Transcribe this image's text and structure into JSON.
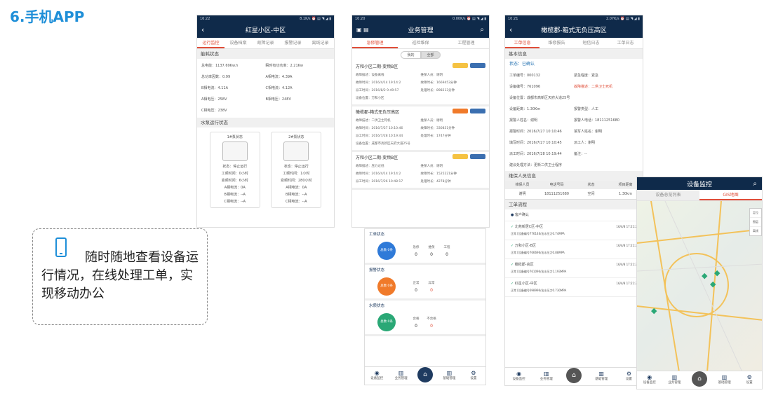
{
  "slide_title": "6.手机APP",
  "callout": "随时随地查看设备运行情况，在线处理工单，实现移动办公",
  "p1": {
    "status_time": "16:22",
    "status_right": "8.1K/s ⏰ ▤ ◥ ◢ ▮",
    "title": "红星小区-中区",
    "tabs": [
      "运行监控",
      "设备档案",
      "故障记录",
      "报警记录",
      "离线记录"
    ],
    "sec1": "能耗状态",
    "rows": [
      [
        "总电能：1137.69Kw.h",
        "瞬时有功功率：2.21Kw"
      ],
      [
        "总功率因数：0.99",
        "A相电流：4.39A"
      ],
      [
        "B相电流：4.11A",
        "C相电流：4.12A"
      ],
      [
        "A相电压：258V",
        "B相电压：248V"
      ],
      [
        "C相电压：238V",
        ""
      ]
    ],
    "sec2": "水泵运行状态",
    "pumps": [
      {
        "name": "1#泵状态",
        "lines": [
          "状态：停止运行",
          "工频时间：0小时",
          "变频时间：6小时",
          "A相电流：0A",
          "B相电流：--A",
          "C相电流：--A"
        ]
      },
      {
        "name": "2#泵状态",
        "lines": [
          "状态：停止运行",
          "工频时间：1小时",
          "变频时间：280小时",
          "A相电流：0A",
          "B相电流：--A",
          "C相电流：--A"
        ]
      }
    ]
  },
  "p2": {
    "status_time": "10:20",
    "status_right": "0.00K/s ⏰ ▤ ◥ ◢ ▮",
    "title": "业务管理",
    "tabs": [
      "急修管理",
      "巡检维保",
      "工程管理"
    ],
    "toggle": [
      "我的",
      "全部"
    ],
    "cards": [
      {
        "title": "万和小区二期-变频B区",
        "b1": "#f5c242",
        "b2": "#3b6fb0",
        "kv": [
          [
            "故障描述：设备离线",
            "维保人员：谢明"
          ],
          [
            "故障时间：2016/4/14 19:14:2",
            "故障时长：1669453分钟"
          ],
          [
            "派工时间：2016/8/2 9:49:57",
            "处理时长：898213分钟"
          ],
          [
            "设备位置：万和小区",
            ""
          ]
        ]
      },
      {
        "title": "橄榄郡-箱式无负压高区",
        "b1": "#f07a2a",
        "b2": "#3b6fb0",
        "kv": [
          [
            "故障描述：二供卫士死机",
            "维保人员：谢明"
          ],
          [
            "故障时间：2016/7/27 10:10:46",
            "故障时长：330831分钟"
          ],
          [
            "派工时间：2016/7/28 10:19:44",
            "处理时长：1747分钟"
          ],
          [
            "设备位置：成都市高新区天府大道25号",
            ""
          ]
        ]
      },
      {
        "title": "万和小区二期-变频B区",
        "b1": "#f5c242",
        "b2": "#3b6fb0",
        "kv": [
          [
            "故障描述：压力过低",
            "维保人员：谢明"
          ],
          [
            "故障时间：2016/4/14 19:14:2",
            "故障时长：1525221分钟"
          ],
          [
            "派工时间：2016/7/26 10:48:17",
            "处理时长：4278分钟"
          ]
        ]
      }
    ]
  },
  "p3": {
    "dash": [
      {
        "label": "工单状态",
        "circle": "总数\n0条",
        "color": "#2f7ad8",
        "stats": [
          [
            "急修",
            "0"
          ],
          [
            "维保",
            "0"
          ],
          [
            "工程",
            "0"
          ]
        ]
      },
      {
        "label": "报警状态",
        "circle": "总数\n0条",
        "color": "#f07a2a",
        "stats": [
          [
            "正常",
            "0"
          ],
          [
            "异常",
            "0"
          ]
        ]
      },
      {
        "label": "水质状态",
        "circle": "总数\n0条",
        "color": "#2aa876",
        "stats": [
          [
            "合格",
            "0"
          ],
          [
            "不合格",
            "0"
          ]
        ]
      }
    ],
    "nav": [
      "设备监控",
      "业务管理",
      "",
      "基础管理",
      "设置"
    ]
  },
  "p4": {
    "status_time": "10:21",
    "status_right": "2.07K/s ⏰ ▤ ◥ ◢ ▮",
    "title": "橄榄郡-箱式无负压高区",
    "tabs": [
      "工单信息",
      "维修报告",
      "短信日志",
      "工单日志"
    ],
    "sec1": "基本信息",
    "state": "状态：已确认",
    "rows": [
      [
        "工单编号：000132",
        "紧急程度：紧急"
      ],
      [
        "设备编号：761096",
        "故障描述：二供卫士死机"
      ],
      [
        "设备位置：成都市高新区天府大道25号",
        ""
      ],
      [
        "设备距离：1.30Km",
        "报警类型：人工"
      ],
      [
        "报警人姓名：谢明",
        "报警人电话：18111251680"
      ],
      [
        "报警时间：2016/7/27 10:10:46",
        "填写人姓名：谢明"
      ],
      [
        "填写时间：2016/7/27 10:10:45",
        "派工人：谢明"
      ],
      [
        "派工时间：2016/7/28 10:19:44",
        "备注：--"
      ],
      [
        "建议处理方法：更新二供卫士程序",
        ""
      ]
    ],
    "sec2": "维保人员信息",
    "th": [
      "维保人员",
      "电话号码",
      "状态",
      "项目距离"
    ],
    "td": [
      "谢明",
      "18111251680",
      "空闲",
      "1.30km"
    ],
    "sec3": "工单流程",
    "flow_head": "客户确认",
    "flows": [
      {
        "name": "北苑新居C区-中区",
        "state": "正常",
        "time": "16/4/8 17:21:2",
        "desc": "[设备编号776146/出水压力0.74MPA"
      },
      {
        "name": "万和小区-B区",
        "state": "正常",
        "time": "16/4/8 17:21:2",
        "desc": "[设备编号766696/出水压力0.88MPA"
      },
      {
        "name": "橄榄郡-高区",
        "state": "正常",
        "time": "16/4/8 17:21:2",
        "desc": "[设备编号761096/出水压力1.193MPA"
      },
      {
        "name": "红星小区-中区",
        "state": "正常",
        "time": "16/4/8 17:21:2",
        "desc": "[设备编号698996/出水压力0.730MPA"
      }
    ],
    "nav": [
      "设备监控",
      "业务管理",
      "",
      "基础管理",
      "设置"
    ]
  },
  "p5": {
    "title": "设备监控",
    "tabs": [
      "设备总览列表",
      "GIS地图"
    ],
    "side": [
      "定位",
      "图层",
      "离线"
    ],
    "nav": [
      "设备监控",
      "业务管理",
      "",
      "基础管理",
      "设置"
    ]
  }
}
